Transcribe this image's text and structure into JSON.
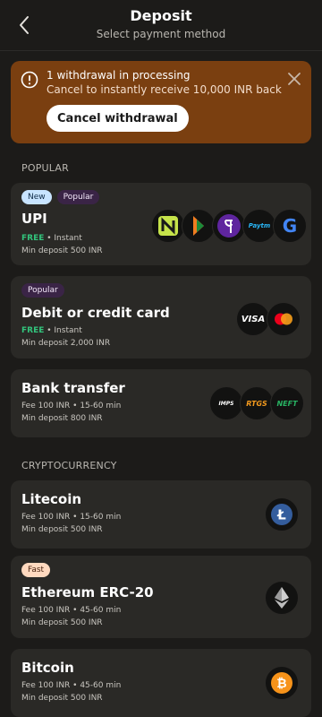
{
  "header": {
    "title": "Deposit",
    "subtitle": "Select payment method"
  },
  "banner": {
    "line1": "1 withdrawal in processing",
    "line2": "Cancel to instantly receive 10,000 INR back",
    "button_label": "Cancel withdrawal",
    "bg_color": "#7a3f10"
  },
  "sections": {
    "popular": "POPULAR",
    "crypto": "CRYPTOCURRENCY"
  },
  "methods": {
    "upi": {
      "badges": [
        "New",
        "Popular"
      ],
      "name": "UPI",
      "free": "FREE",
      "fee_rest": " • Instant",
      "min": "Min deposit 500 INR",
      "icons": [
        "navi-icon",
        "bhim-icon",
        "phonepe-icon",
        "paytm-icon",
        "google-pay-icon"
      ],
      "paytm_text": "Paytm",
      "google_text": "G"
    },
    "card": {
      "badges": [
        "Popular"
      ],
      "name": "Debit or credit card",
      "free": "FREE",
      "fee_rest": " • Instant",
      "min": "Min deposit 2,000 INR",
      "visa_text": "VISA"
    },
    "bank": {
      "name": "Bank transfer",
      "fee": "Fee 100 INR • 15-60 min",
      "min": "Min deposit 800 INR",
      "imps_text": "IMPS",
      "rtgs_text": "RTGS",
      "neft_text": "NEFT"
    },
    "litecoin": {
      "name": "Litecoin",
      "fee": "Fee 100 INR • 15-60 min",
      "min": "Min deposit 500 INR",
      "symbol": "Ł"
    },
    "ethereum": {
      "badges": [
        "Fast"
      ],
      "name": "Ethereum ERC-20",
      "fee": "Fee 100 INR • 45-60 min",
      "min": "Min deposit 500 INR"
    },
    "bitcoin": {
      "name": "Bitcoin",
      "fee": "Fee 100 INR • 45-60 min",
      "min": "Min deposit 500 INR",
      "symbol": "₿"
    }
  },
  "colors": {
    "free_green": "#32c47c",
    "card_bg": "#2a2926",
    "page_bg": "#1c1b19"
  }
}
